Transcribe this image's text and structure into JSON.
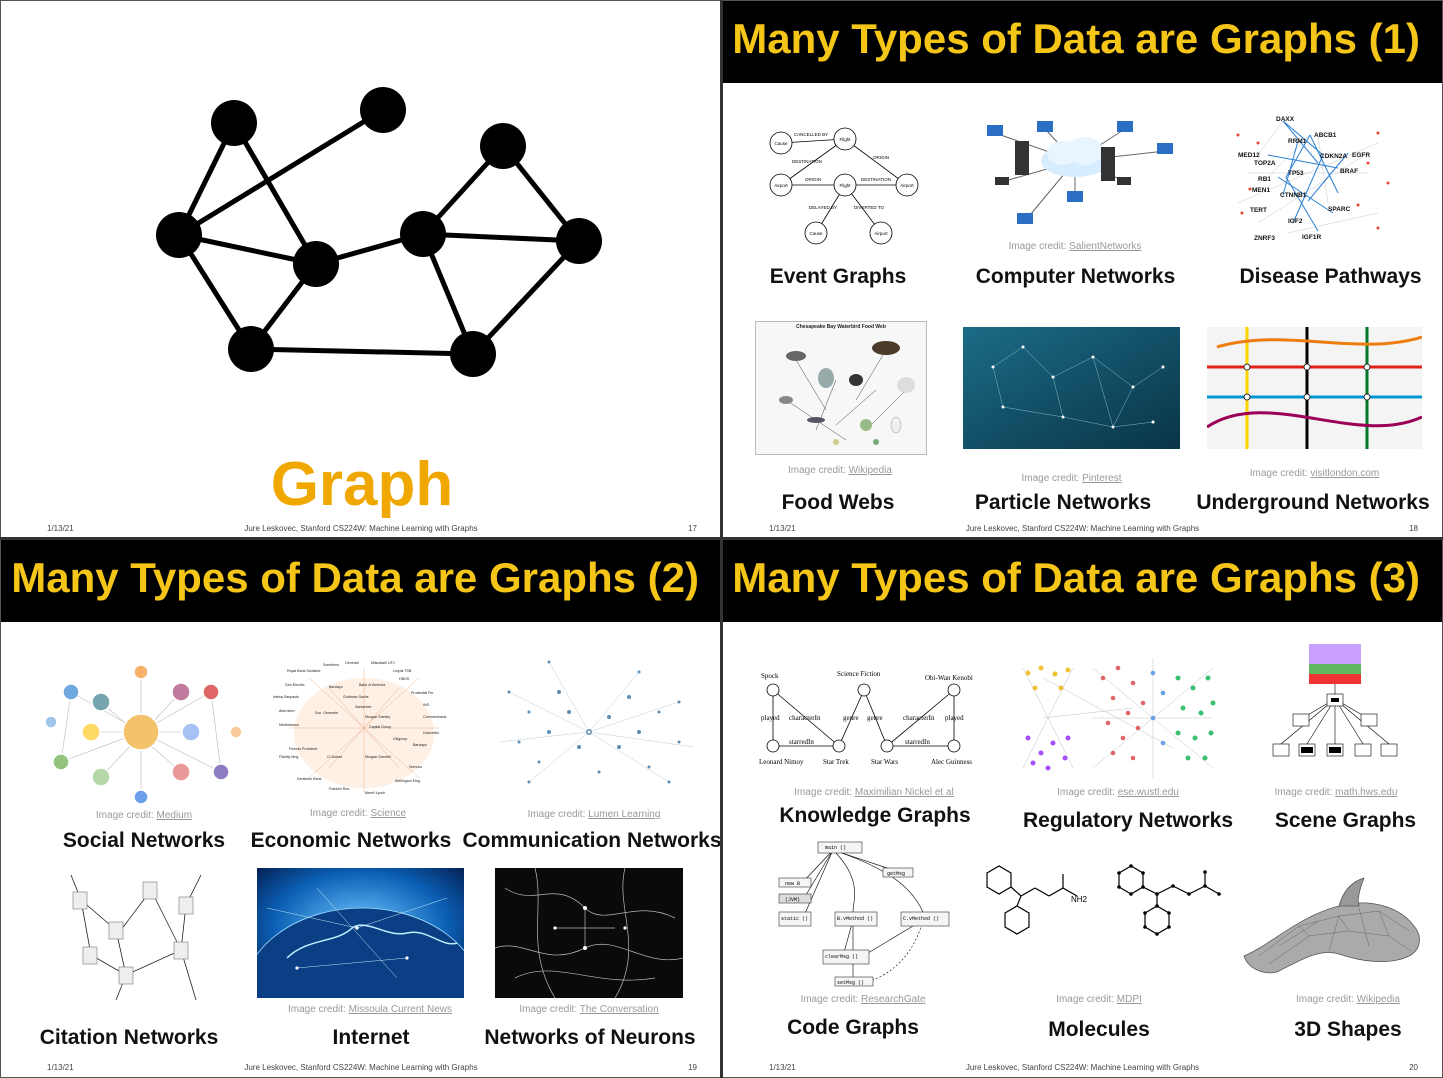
{
  "slide17": {
    "graph_label": "Graph",
    "date": "1/13/21",
    "author": "Jure Leskovec, Stanford CS224W: Machine Learning with Graphs",
    "page": "17"
  },
  "slide18": {
    "title": "Many Types of Data are Graphs (1)",
    "items": [
      {
        "caption": "Event Graphs",
        "credit_prefix": "",
        "credit_link": ""
      },
      {
        "caption": "Computer Networks",
        "credit_prefix": "Image credit:",
        "credit_link": "SalientNetworks"
      },
      {
        "caption": "Disease Pathways",
        "credit_prefix": "",
        "credit_link": ""
      },
      {
        "caption": "Food Webs",
        "credit_prefix": "Image credit:",
        "credit_link": "Wikipedia"
      },
      {
        "caption": "Particle Networks",
        "credit_prefix": "Image credit:",
        "credit_link": "Pinterest"
      },
      {
        "caption": "Underground Networks",
        "credit_prefix": "Image credit:",
        "credit_link": "visitlondon.com"
      }
    ],
    "event_graph_labels": [
      "CANCELLED BY",
      "Cause",
      "Flight",
      "DESTINATION",
      "ORIGIN",
      "Airport",
      "ORIGIN",
      "Flight",
      "DESTINATION",
      "Airport",
      "DELAYED BY",
      "DIVERTED TO",
      "Cause",
      "Airport"
    ],
    "disease_genes": [
      "DAXX",
      "ABCB1",
      "MED12",
      "RRM1",
      "CDKN2A",
      "EGFR",
      "TOP2A",
      "TP53",
      "BRAF",
      "RB1",
      "MEN1",
      "CTNNB1",
      "TERT",
      "SPARC",
      "IGF2",
      "ZNRF3",
      "IGF1R"
    ],
    "food_web_title": "Chesapeake Bay Waterbird Food Web",
    "date": "1/13/21",
    "author": "Jure Leskovec, Stanford CS224W: Machine Learning with Graphs",
    "page": "18"
  },
  "slide19": {
    "title": "Many Types of Data are Graphs (2)",
    "items": [
      {
        "caption": "Social Networks",
        "credit_prefix": "Image credit:",
        "credit_link": "Medium"
      },
      {
        "caption": "Economic Networks",
        "credit_prefix": "Image credit:",
        "credit_link": "Science"
      },
      {
        "caption": "Communication Networks",
        "credit_prefix": "Image credit:",
        "credit_link": "Lumen Learning"
      },
      {
        "caption": "Citation Networks",
        "credit_prefix": "",
        "credit_link": ""
      },
      {
        "caption": "Internet",
        "credit_prefix": "Image credit:",
        "credit_link": "Missoula Current News"
      },
      {
        "caption": "Networks of Neurons",
        "credit_prefix": "Image credit:",
        "credit_link": "The Conversation"
      }
    ],
    "economic_labels": [
      "Royal Bank Scotland",
      "Sumitomo",
      "Generali",
      "Mitsubishi UFJ",
      "Lloyds TSB",
      "HBOS",
      "Gen.Electric",
      "Bank of America",
      "Prudential Fin.",
      "Barclays",
      "Intesa-Sanpaolo",
      "Goldman Sachs",
      "ING",
      "Aberdeen",
      "Soc. Generale",
      "Santander",
      "Morgan Stanley",
      "Commerzbank",
      "Mediobanca",
      "Capital Group",
      "Unicredito",
      "Citigroup",
      "Barclays",
      "Fidelity Mng",
      "Friends Provident",
      "Cr.Suisse",
      "Morgan Grenfell",
      "Nomura",
      "Deutsche Bank",
      "Franklin Res.",
      "Merrill Lynch",
      "Wellington Mng."
    ],
    "date": "1/13/21",
    "author": "Jure Leskovec, Stanford CS224W: Machine Learning with Graphs",
    "page": "19"
  },
  "slide20": {
    "title": "Many Types of Data are Graphs (3)",
    "items": [
      {
        "caption": "Knowledge Graphs",
        "credit_prefix": "Image credit:",
        "credit_link": "Maximilian Nickel et al"
      },
      {
        "caption": "Regulatory Networks",
        "credit_prefix": "Image credit:",
        "credit_link": "ese.wustl.edu"
      },
      {
        "caption": "Scene Graphs",
        "credit_prefix": "Image credit:",
        "credit_link": "math.hws.edu"
      },
      {
        "caption": "Code Graphs",
        "credit_prefix": "Image credit:",
        "credit_link": "ResearchGate"
      },
      {
        "caption": "Molecules",
        "credit_prefix": "Image credit:",
        "credit_link": "MDPI"
      },
      {
        "caption": "3D Shapes",
        "credit_prefix": "Image credit:",
        "credit_link": "Wikipedia"
      }
    ],
    "kg_labels": [
      "Spock",
      "Science Fiction",
      "Obi-Wan Kenobi",
      "played",
      "characterIn",
      "genre",
      "genre",
      "characterIn",
      "played",
      "starredIn",
      "starredIn",
      "Leonard Nimoy",
      "Star Trek",
      "Star Wars",
      "Alec Guinness"
    ],
    "code_labels": [
      "main ()",
      "new B",
      "(JVM)",
      "static ()",
      "B.vMethod ()",
      "C.vMethod ()",
      "getMsg",
      "clearMsg ()",
      "setMsg ()"
    ],
    "molecule_label": "NH2",
    "date": "1/13/21",
    "author": "Jure Leskovec, Stanford CS224W: Machine Learning with Graphs",
    "page": "20"
  }
}
